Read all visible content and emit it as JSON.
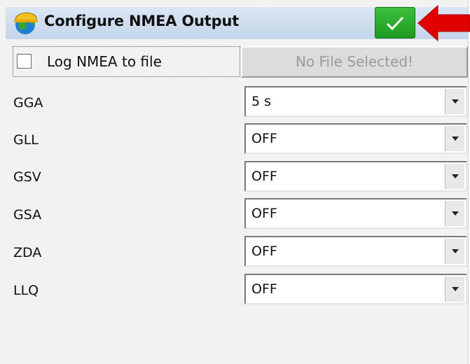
{
  "window": {
    "title": "Configure NMEA Output",
    "app_icon": "globe-helmet-icon",
    "ok_icon": "checkmark-icon",
    "arrow_icon": "red-arrow-annotation"
  },
  "log": {
    "checkbox_label": "Log NMEA to file",
    "checked": false,
    "file_button_label": "No File Selected!"
  },
  "messages": [
    {
      "label": "GGA",
      "value": "5 s"
    },
    {
      "label": "GLL",
      "value": "OFF"
    },
    {
      "label": "GSV",
      "value": "OFF"
    },
    {
      "label": "GSA",
      "value": "OFF"
    },
    {
      "label": "ZDA",
      "value": "OFF"
    },
    {
      "label": "LLQ",
      "value": "OFF"
    }
  ],
  "colors": {
    "ok_button": "#2aad2a",
    "arrow": "#e00000",
    "titlebar": "#c9d9ee"
  }
}
